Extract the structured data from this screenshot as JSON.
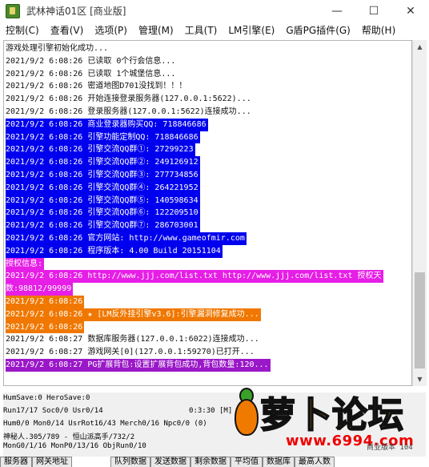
{
  "window": {
    "title": "武林神话01区 [商业版]",
    "minimize": "—",
    "maximize": "☐",
    "close": "✕"
  },
  "menu": [
    "控制(C)",
    "查看(V)",
    "选项(P)",
    "管理(M)",
    "工具(T)",
    "LM引擎(E)",
    "G盾PG插件(G)",
    "帮助(H)"
  ],
  "log": [
    {
      "text": "游戏处理引擎初始化成功...",
      "style": "plain"
    },
    {
      "text": "2021/9/2 6:08:26 已读取 0个行会信息...",
      "style": "plain"
    },
    {
      "text": "2021/9/2 6:08:26 已读取 1个城堡信息...",
      "style": "plain"
    },
    {
      "text": "2021/9/2 6:08:26 密道地图D701没找到！！！",
      "style": "plain"
    },
    {
      "text": "2021/9/2 6:08:26 开始连接登录服务器(127.0.0.1:5622)...",
      "style": "plain"
    },
    {
      "text": "2021/9/2 6:08:26 登录服务器(127.0.0.1:5622)连接成功...",
      "style": "plain"
    },
    {
      "text": "2021/9/2 6:08:26 商业登录器购买QQ: 718846686",
      "style": "blue"
    },
    {
      "text": "2021/9/2 6:08:26 引擎功能定制QQ: 718846686",
      "style": "blue"
    },
    {
      "text": "2021/9/2 6:08:26 引擎交流QQ群①: 27299223",
      "style": "blue"
    },
    {
      "text": "2021/9/2 6:08:26 引擎交流QQ群②: 249126912",
      "style": "blue"
    },
    {
      "text": "2021/9/2 6:08:26 引擎交流QQ群③: 277734856",
      "style": "blue"
    },
    {
      "text": "2021/9/2 6:08:26 引擎交流QQ群④: 264221952",
      "style": "blue"
    },
    {
      "text": "2021/9/2 6:08:26 引擎交流QQ群⑤: 140598634",
      "style": "blue"
    },
    {
      "text": "2021/9/2 6:08:26 引擎交流QQ群⑥: 122209510",
      "style": "blue"
    },
    {
      "text": "2021/9/2 6:08:26 引擎交流QQ群⑦: 286703001",
      "style": "blue"
    },
    {
      "text": "2021/9/2 6:08:26 官方网站: http://www.gameofmir.com",
      "style": "blue"
    },
    {
      "text": "2021/9/2 6:08:26 程序版本: 4.00 Build 20151104",
      "style": "blue"
    },
    {
      "text": "授权信息:",
      "style": "magenta"
    },
    {
      "text": "2021/9/2 6:08:26 http://www.jjj.com/list.txt http://www.jjj.com/list.txt 授权天",
      "style": "magenta"
    },
    {
      "text": "数:98812/99999",
      "style": "magenta"
    },
    {
      "text": "2021/9/2 6:08:26",
      "style": "orange"
    },
    {
      "text": "2021/9/2 6:08:26 ★ [LM反外挂引擎v3.6]:引擎漏洞修复成功...",
      "style": "orange"
    },
    {
      "text": "2021/9/2 6:08:26",
      "style": "orange"
    },
    {
      "text": "2021/9/2 6:08:27 数据库服务器(127.0.0.1:6022)连接成功...",
      "style": "plain"
    },
    {
      "text": "2021/9/2 6:08:27 游戏网关[0](127.0.0.1:59270)已打开...",
      "style": "plain"
    },
    {
      "text": "2021/9/2 6:08:27 PG扩展背包:设置扩展背包成功,背包数量:120...",
      "style": "purple"
    }
  ],
  "status": {
    "row1": "HumSave:0 HeroSave:0",
    "row2a": "Run17/17 Soc0/0 Usr0/14",
    "row2b": "0:3:30 [M]",
    "row3": "Hum0/0 Mon0/14 UsrRot16/43 Merch0/16 Npc0/0 (0)",
    "row4": "神秘人.305/789 - 恒山派高手/732/2",
    "row5": "MonG0/1/16 MonP0/13/16 ObjRun0/10",
    "side_label": "商业版本",
    "side_value": "104"
  },
  "tabs": [
    "服务器",
    "网关地址",
    "队列数据",
    "发送数据",
    "剩余数据",
    "平均值",
    "数据库",
    "最高人数"
  ],
  "watermark": {
    "text": "萝卜论坛",
    "url": "www.6994.com"
  },
  "colors": {
    "blue": "#0000ee",
    "magenta": "#e61ee6",
    "orange": "#f07800",
    "purple": "#9a18c8"
  }
}
